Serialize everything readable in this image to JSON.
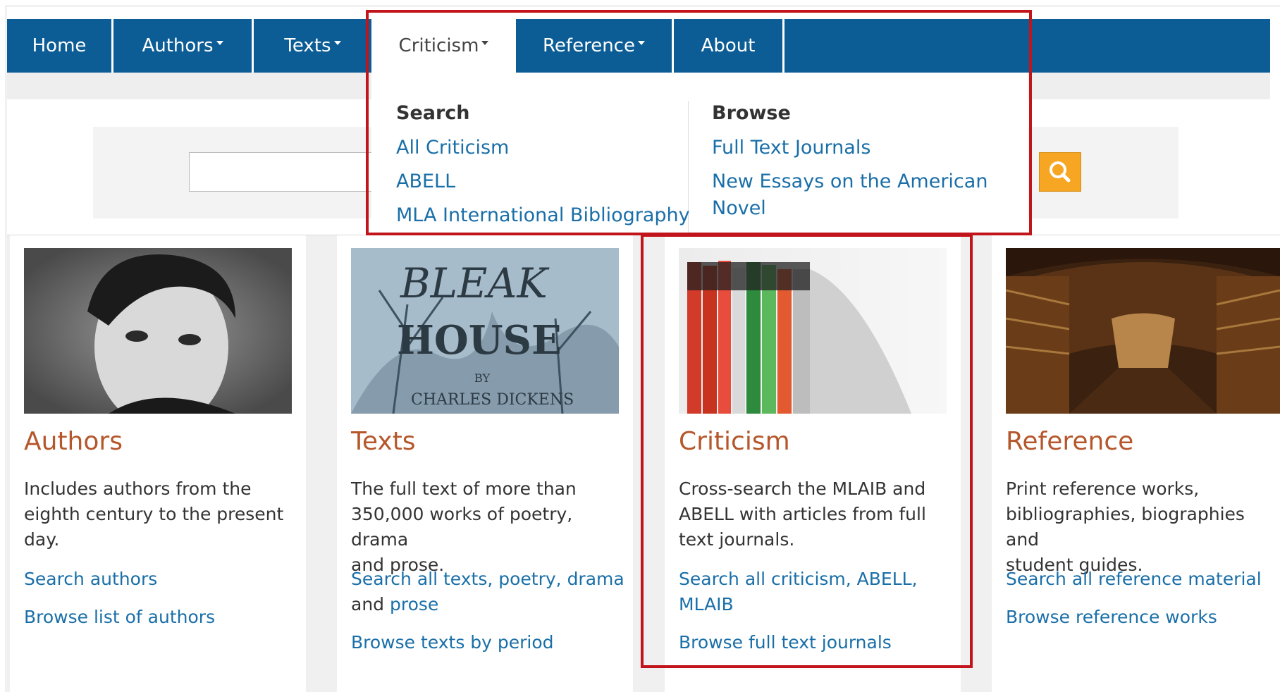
{
  "nav": {
    "home": "Home",
    "authors": "Authors",
    "texts": "Texts",
    "criticism": "Criticism",
    "reference": "Reference",
    "about": "About"
  },
  "search": {
    "value": ""
  },
  "dropdown": {
    "search_heading": "Search",
    "search_links": [
      "All Criticism",
      "ABELL",
      "MLA International Bibliography"
    ],
    "browse_heading": "Browse",
    "browse_links": [
      "Full Text Journals",
      "New Essays on the American",
      "Novel"
    ]
  },
  "cards": [
    {
      "title": "Authors",
      "desc": [
        "Includes authors from the",
        "eighth century to the present",
        "day."
      ],
      "links": [
        "Search authors",
        "Browse list of authors"
      ]
    },
    {
      "title": "Texts",
      "desc": [
        "The full text of more than",
        "350,000 works of poetry, drama",
        "and prose."
      ],
      "links": [
        "Search all texts, poetry, drama",
        "and",
        "prose",
        "Browse texts by period"
      ],
      "image_text": [
        "BLEAK",
        "HOUSE",
        "BY",
        "CHARLES DICKENS"
      ]
    },
    {
      "title": "Criticism",
      "desc": [
        "Cross-search the MLAIB and",
        "ABELL with articles from full",
        "text journals."
      ],
      "links": [
        "Search all criticism, ABELL,",
        "MLAIB",
        "Browse full text journals"
      ]
    },
    {
      "title": "Reference",
      "desc": [
        "Print reference works,",
        "bibliographies, biographies and",
        "student guides."
      ],
      "links": [
        "Search all reference material",
        "Browse reference works"
      ]
    }
  ],
  "colors": {
    "nav_bg": "#0c5c95",
    "highlight": "#c2141b",
    "title": "#b5572b",
    "link": "#1a6fa8",
    "search_button": "#f6a623"
  }
}
